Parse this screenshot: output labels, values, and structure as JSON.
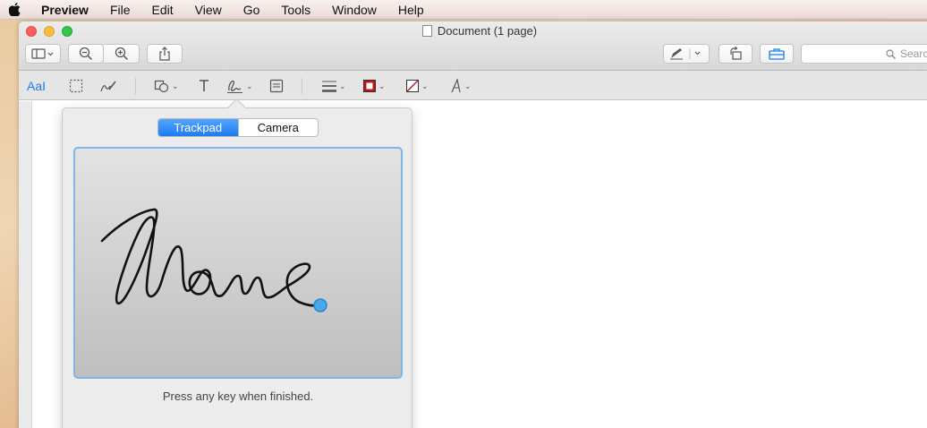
{
  "menubar": {
    "app_name": "Preview",
    "items": [
      "File",
      "Edit",
      "View",
      "Go",
      "Tools",
      "Window",
      "Help"
    ]
  },
  "window": {
    "title": "Document (1 page)"
  },
  "toolbar": {
    "search_placeholder": "Search"
  },
  "markup": {
    "text_style_label": "AaI"
  },
  "signature_popover": {
    "tabs": [
      "Trackpad",
      "Camera"
    ],
    "active_tab": "Trackpad",
    "hint": "Press any key when finished."
  },
  "colors": {
    "accent": "#1b7cf2",
    "pad_border": "#7fb5e8",
    "close": "#fc605c",
    "minimize": "#fdbc40",
    "maximize": "#34c84a",
    "border_color_swatch": "#c0141c"
  }
}
